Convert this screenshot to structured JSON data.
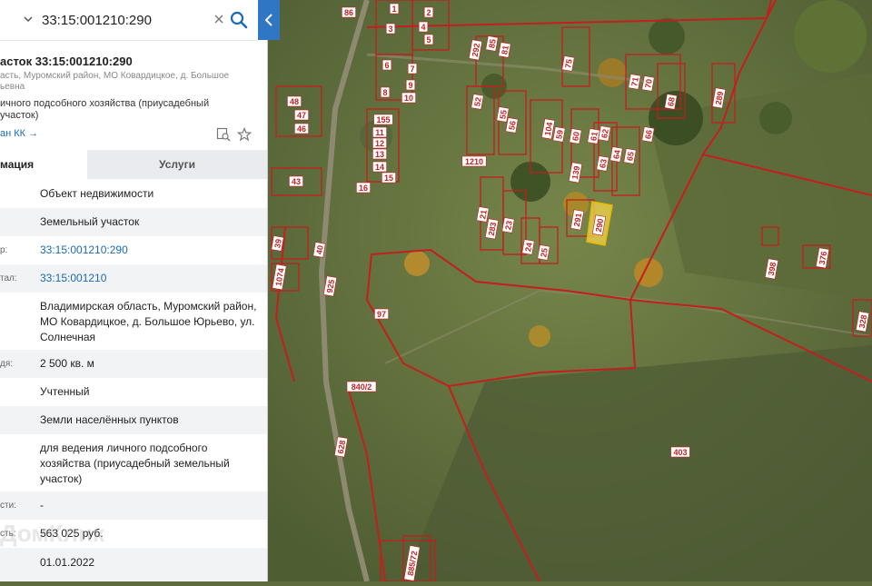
{
  "search": {
    "value": "33:15:001210:290"
  },
  "card": {
    "title": "асток 33:15:001210:290",
    "subtitle": "асть, Муромский район, МО Ковардицкое, д. Большое ьевна",
    "purpose_short": "ичного подсобного хозяйства (приусадебный участок)",
    "plan_link": "ан КК →"
  },
  "tabs": {
    "info": "мация",
    "services": "Услуги"
  },
  "rows": [
    {
      "label": "",
      "value": "Объект недвижимости"
    },
    {
      "label": "",
      "value": "Земельный участок"
    },
    {
      "label": "р:",
      "value": "33:15:001210:290"
    },
    {
      "label": "тал:",
      "value": "33:15:001210"
    },
    {
      "label": "",
      "value": "Владимирская область, Муромский район, МО Ковардицкое, д. Большое Юрьево, ул. Солнечная"
    },
    {
      "label": "дя:",
      "value": "2 500 кв. м"
    },
    {
      "label": "",
      "value": "Учтенный"
    },
    {
      "label": "",
      "value": "Земли населённых пунктов"
    },
    {
      "label": "",
      "value": "для ведения личного подсобного хозяйства (приусадебный земельный участок)"
    },
    {
      "label": "сти:",
      "value": "-"
    },
    {
      "label": "сть:",
      "value": "563 025 руб."
    },
    {
      "label": "",
      "value": "01.01.2022"
    }
  ],
  "watermark": "ДомКлик",
  "map": {
    "parcel_labels": [
      "86",
      "1",
      "2",
      "3",
      "4",
      "5",
      "6",
      "7",
      "8",
      "9",
      "10",
      "11",
      "12",
      "13",
      "14",
      "15",
      "16",
      "155",
      "43",
      "292",
      "85",
      "81",
      "75",
      "71",
      "70",
      "68",
      "289",
      "52",
      "55",
      "56",
      "104",
      "59",
      "60",
      "61",
      "62",
      "63",
      "64",
      "65",
      "66",
      "40",
      "39",
      "1074",
      "1210",
      "139",
      "291",
      "290",
      "21",
      "283",
      "23",
      "24",
      "25",
      "925",
      "97",
      "840/2",
      "403",
      "628",
      "885/72",
      "398",
      "376",
      "328",
      "47",
      "46",
      "48"
    ],
    "highlight_label": "290",
    "colors": {
      "boundary": "#c41e1e",
      "highlight": "#f5d64a"
    }
  }
}
